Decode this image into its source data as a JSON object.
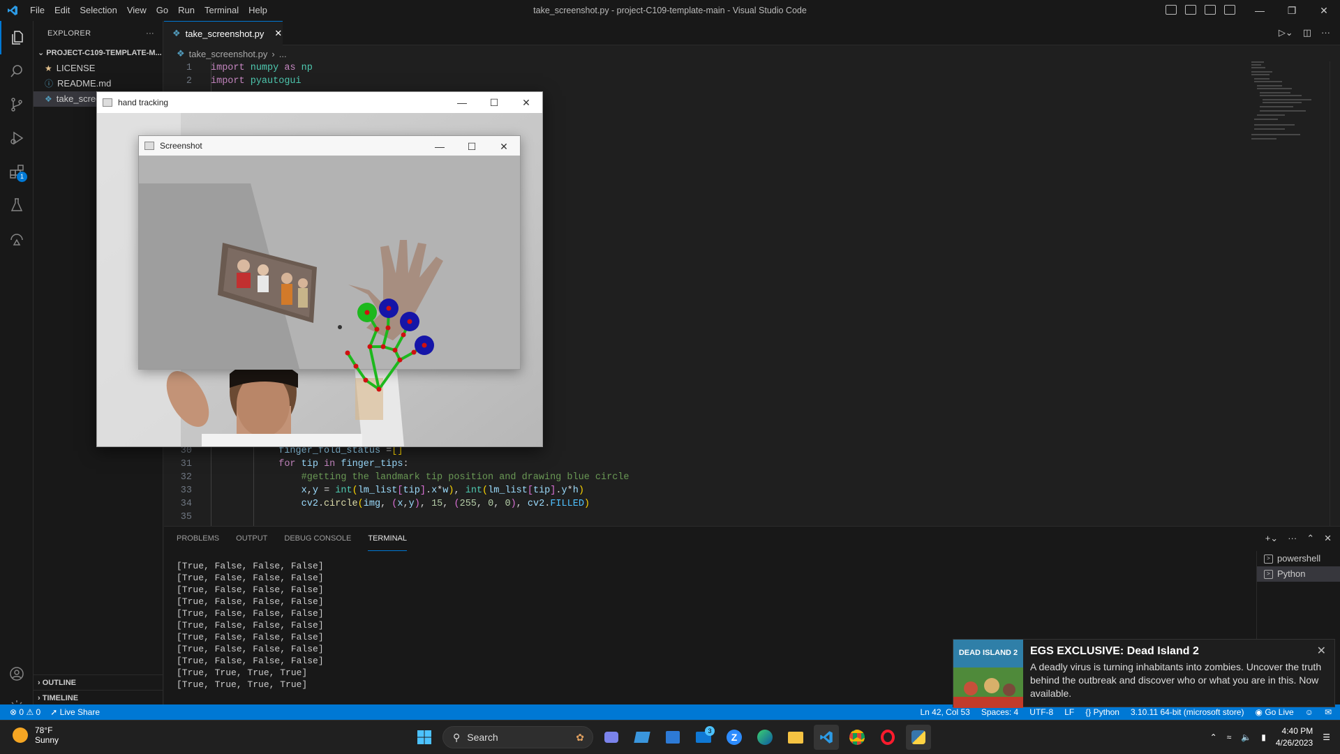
{
  "window": {
    "title": "take_screenshot.py - project-C109-template-main - Visual Studio Code",
    "menu": [
      "File",
      "Edit",
      "Selection",
      "View",
      "Go",
      "Run",
      "Terminal",
      "Help"
    ]
  },
  "activity_bar": {
    "items": [
      "explorer-icon",
      "search-icon",
      "source-control-icon",
      "run-debug-icon",
      "extensions-icon",
      "testing-icon",
      "remote-explorer-icon"
    ],
    "extensions_badge": "1",
    "bottom": [
      "accounts-icon",
      "settings-gear-icon"
    ]
  },
  "sidebar": {
    "header": "EXPLORER",
    "more": "···",
    "project": "PROJECT-C109-TEMPLATE-M...",
    "files": [
      {
        "name": "LICENSE",
        "icon": "license-icon"
      },
      {
        "name": "README.md",
        "icon": "info-icon"
      },
      {
        "name": "take_screenshot.py",
        "icon": "python-icon"
      }
    ],
    "outline": "OUTLINE",
    "timeline": "TIMELINE"
  },
  "editor": {
    "tab": "take_screenshot.py",
    "breadcrumb": [
      "take_screenshot.py",
      "..."
    ],
    "lines_top": [
      {
        "n": "1",
        "text": "import numpy as np"
      },
      {
        "n": "2",
        "text": "import pyautogui"
      }
    ],
    "lines_bottom": [
      {
        "n": "30",
        "text": "finger_fold_status =[]"
      },
      {
        "n": "31",
        "text": "for tip in finger_tips:"
      },
      {
        "n": "32",
        "text": "#getting the landmark tip position and drawing blue circle"
      },
      {
        "n": "33",
        "text": "x,y = int(lm_list[tip].x*w), int(lm_list[tip].y*h)"
      },
      {
        "n": "34",
        "text": "cv2.circle(img, (x,y), 15, (255, 0, 0), cv2.FILLED)"
      },
      {
        "n": "35",
        "text": ""
      }
    ]
  },
  "panel": {
    "tabs": [
      "PROBLEMS",
      "OUTPUT",
      "DEBUG CONSOLE",
      "TERMINAL"
    ],
    "active_tab": "TERMINAL",
    "terminal_lines": [
      "[True, False, False, False]",
      "[True, False, False, False]",
      "[True, False, False, False]",
      "[True, False, False, False]",
      "[True, False, False, False]",
      "[True, False, False, False]",
      "[True, False, False, False]",
      "[True, False, False, False]",
      "[True, False, False, False]",
      "[True, True, True, True]",
      "[True, True, True, True]"
    ],
    "terminals": [
      "powershell",
      "Python"
    ]
  },
  "statusbar": {
    "errors": "0",
    "warnings": "0",
    "live_share": "Live Share",
    "position": "Ln 42, Col 53",
    "spaces": "Spaces: 4",
    "encoding": "UTF-8",
    "eol": "LF",
    "language": "Python",
    "interpreter": "3.10.11 64-bit (microsoft store)",
    "go_live": "Go Live"
  },
  "hand_window": {
    "title": "hand tracking"
  },
  "screenshot_window": {
    "title": "Screenshot"
  },
  "toast": {
    "title": "EGS EXCLUSIVE: Dead Island 2",
    "text": "A deadly virus is turning inhabitants into zombies. Uncover the truth behind the outbreak and discover who or what you are in this. Now available.",
    "art_label": "DEAD ISLAND 2"
  },
  "taskbar": {
    "temperature": "78°F",
    "weather": "Sunny",
    "search_placeholder": "Search",
    "time": "4:40 PM",
    "date": "4/26/2023",
    "mail_badge": "3"
  },
  "colors": {
    "accent": "#0078d4",
    "landmark_green": "#1db81d",
    "landmark_blue": "#1515a8",
    "landmark_red": "#d01010"
  }
}
